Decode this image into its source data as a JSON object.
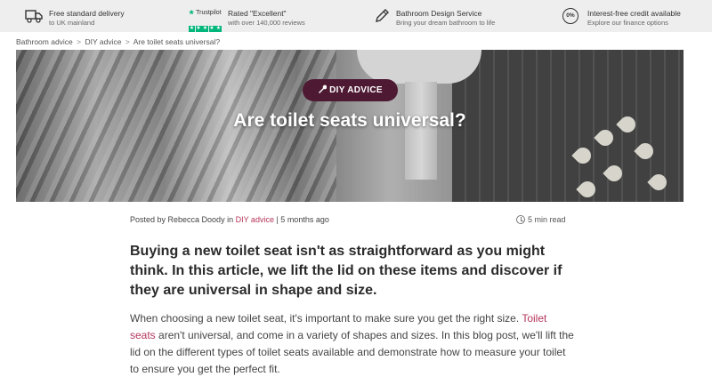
{
  "usp_bar": {
    "items": [
      {
        "icon": "truck-icon",
        "title": "Free standard delivery",
        "subtitle": "to UK mainland"
      },
      {
        "icon": "trustpilot-stars-icon",
        "title": "Rated \"Excellent\"",
        "subtitle": "with over 140,000 reviews",
        "logo_text": "Trustpilot"
      },
      {
        "icon": "pencil-icon",
        "title": "Bathroom Design Service",
        "subtitle": "Bring your dream bathroom to life"
      },
      {
        "icon": "zero-percent-icon",
        "title": "Interest-free credit available",
        "subtitle": "Explore our finance options",
        "icon_text": "0%"
      }
    ]
  },
  "breadcrumb": {
    "items": [
      "Bathroom advice",
      "DIY advice",
      "Are toilet seats universal?"
    ],
    "separator": ">"
  },
  "hero": {
    "badge": "DIY ADVICE",
    "title": "Are toilet seats universal?"
  },
  "meta": {
    "posted_by_prefix": "Posted by Rebecca Doody in",
    "category_link": "DIY advice",
    "time_ago": "| 5 months ago",
    "read_time": "5 min read"
  },
  "article": {
    "intro": "Buying a new toilet seat isn't as straightforward as you might think. In this article, we lift the lid on these items and discover if they are universal in shape and size.",
    "body_before_link": "When choosing a new toilet seat, it's important to make sure you get the right size.",
    "body_link": "Toilet seats",
    "body_after_link": "aren't universal, and come in a variety of shapes and sizes. In this blog post, we'll lift the lid on the different types of toilet seats available and demonstrate how to measure your toilet to ensure you get the perfect fit."
  },
  "colors": {
    "accent": "#b5365b",
    "badge_bg": "#4e1a33",
    "trustpilot": "#00b67a",
    "usp_bg": "#eeeeee"
  }
}
